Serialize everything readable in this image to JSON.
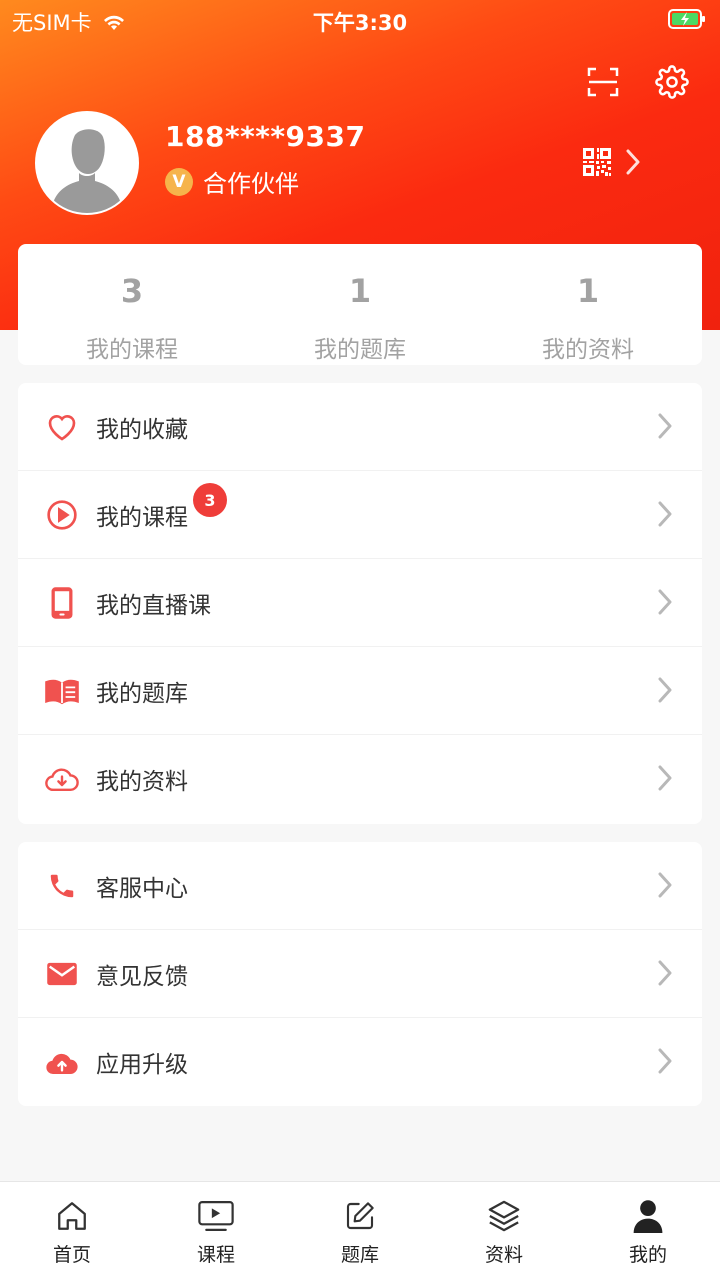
{
  "status_bar": {
    "carrier": "无SIM卡",
    "time": "下午3:30"
  },
  "profile": {
    "phone": "188****9337",
    "badge_letter": "V",
    "role": "合作伙伴"
  },
  "stats": [
    {
      "count": "3",
      "label": "我的课程"
    },
    {
      "count": "1",
      "label": "我的题库"
    },
    {
      "count": "1",
      "label": "我的资料"
    }
  ],
  "menu_primary": [
    {
      "label": "我的收藏",
      "icon": "heart-icon"
    },
    {
      "label": "我的课程",
      "icon": "play-circle-icon",
      "badge": "3"
    },
    {
      "label": "我的直播课",
      "icon": "mobile-phone-icon"
    },
    {
      "label": "我的题库",
      "icon": "open-book-icon"
    },
    {
      "label": "我的资料",
      "icon": "cloud-download-icon"
    }
  ],
  "menu_secondary": [
    {
      "label": "客服中心",
      "icon": "phone-icon"
    },
    {
      "label": "意见反馈",
      "icon": "mail-icon"
    },
    {
      "label": "应用升级",
      "icon": "cloud-upload-icon"
    }
  ],
  "tabs": [
    {
      "label": "首页",
      "icon": "home-icon"
    },
    {
      "label": "课程",
      "icon": "video-icon"
    },
    {
      "label": "题库",
      "icon": "edit-icon"
    },
    {
      "label": "资料",
      "icon": "layers-icon"
    },
    {
      "label": "我的",
      "icon": "user-icon",
      "active": true
    }
  ],
  "colors": {
    "accent": "#f0524f",
    "header_start": "#ff8a1e",
    "header_end": "#f0220e",
    "badge": "#ef3d39",
    "vip": "#f6b44b"
  }
}
